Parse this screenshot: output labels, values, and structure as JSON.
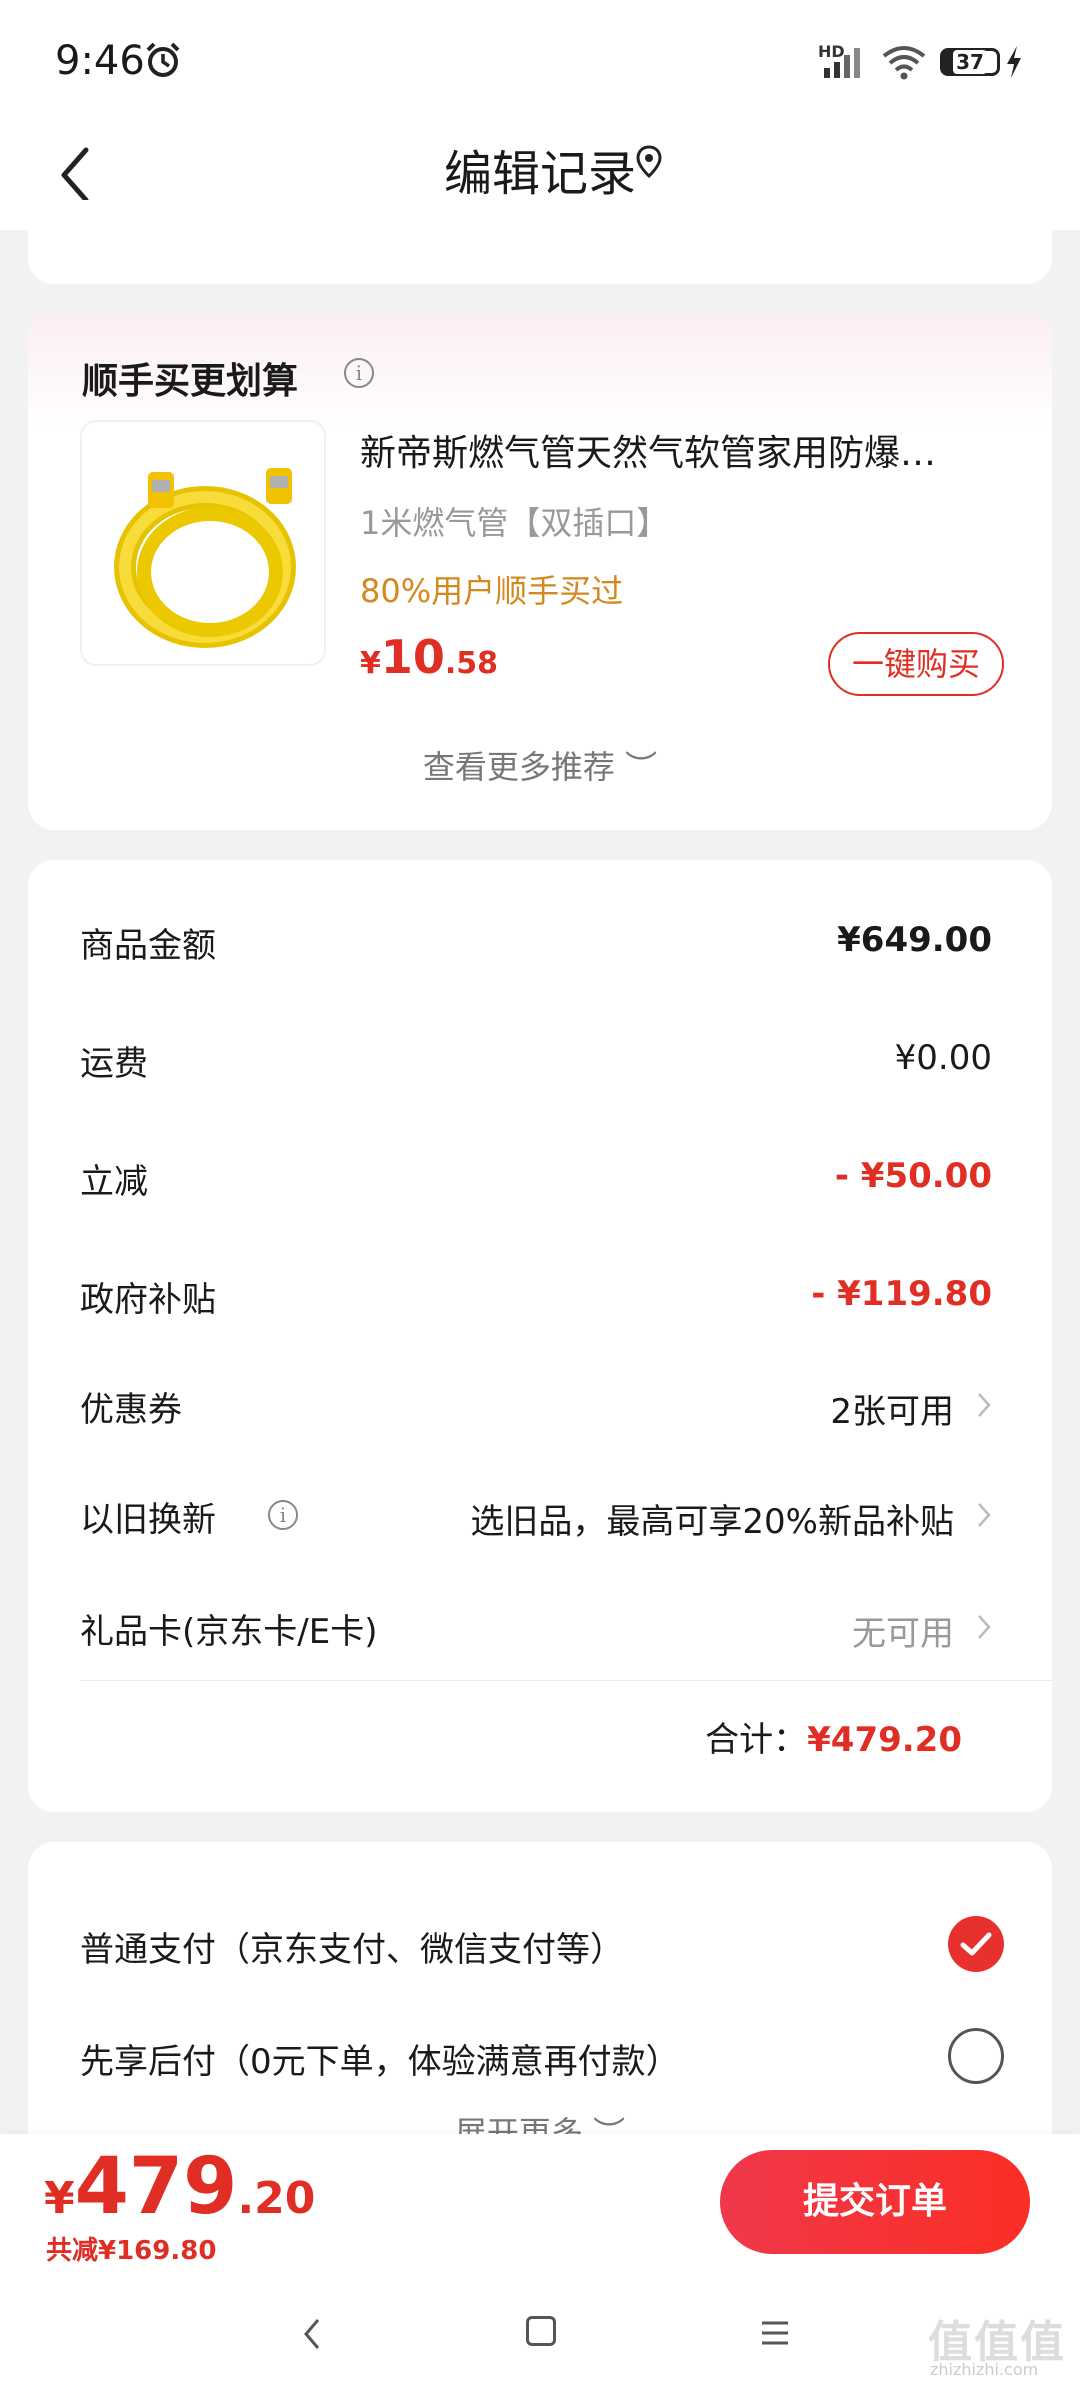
{
  "status_bar": {
    "time": "9:46",
    "network": "HD",
    "battery": "37"
  },
  "nav": {
    "title": "编辑记录"
  },
  "recommend": {
    "title": "顺手买更划算",
    "product_name": "新帝斯燃气管天然气软管家用防爆…",
    "spec": "1米燃气管【双插口】",
    "social": "80%用户顺手买过",
    "price_currency": "¥",
    "price_int": "10",
    "price_dec": ".58",
    "buy_label": "一键购买",
    "more_label": "查看更多推荐 ︶"
  },
  "summary": {
    "rows": [
      {
        "label": "商品金额",
        "value": "¥649.00"
      },
      {
        "label": "运费",
        "value": "¥0.00"
      },
      {
        "label": "立减",
        "value": "- ¥50.00"
      },
      {
        "label": "政府补贴",
        "value": "- ¥119.80"
      },
      {
        "label": "优惠券",
        "value": "2张可用"
      },
      {
        "label": "以旧换新",
        "value": "选旧品，最高可享20%新品补贴"
      },
      {
        "label": "礼品卡(京东卡/E卡)",
        "value": "无可用"
      }
    ],
    "total_label": "合计：",
    "total_value": "¥479.20"
  },
  "payment": {
    "options": [
      {
        "label": "普通支付（京东支付、微信支付等）",
        "selected": true
      },
      {
        "label": "先享后付（0元下单，体验满意再付款）",
        "selected": false
      }
    ],
    "more_label": "展开更多 ︶"
  },
  "bottom": {
    "price_currency": "¥",
    "price_int": "479",
    "price_dec": ".20",
    "saved": "共减¥169.80",
    "submit_label": "提交订单"
  },
  "watermark": {
    "text": "值值值",
    "sub": "zhizhizhi.com"
  },
  "colors": {
    "accent": "#e02e24",
    "social": "#d4881e",
    "text": "#1a1a1a",
    "muted": "#999999"
  }
}
